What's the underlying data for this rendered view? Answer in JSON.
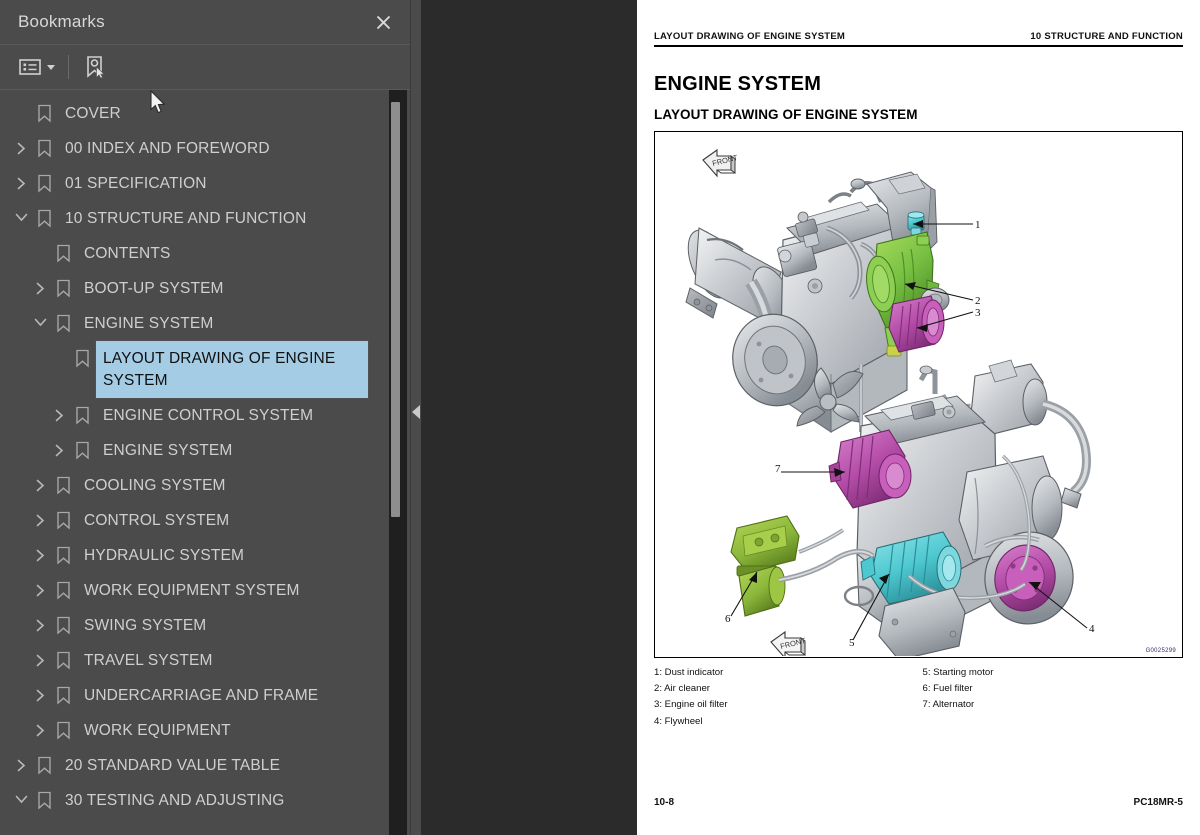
{
  "sidebar": {
    "title": "Bookmarks",
    "close_label": "×",
    "toolbar": {
      "options_icon": "list-options-icon",
      "options_caret": "chevron-down-icon",
      "new_bookmark_icon": "bookmark-pointer-icon"
    },
    "items": [
      {
        "label": "COVER",
        "level": 0,
        "state": "leaf",
        "selected": false
      },
      {
        "label": "00 INDEX AND FOREWORD",
        "level": 0,
        "state": "collapsed",
        "selected": false
      },
      {
        "label": "01 SPECIFICATION",
        "level": 0,
        "state": "collapsed",
        "selected": false
      },
      {
        "label": "10 STRUCTURE AND FUNCTION",
        "level": 0,
        "state": "expanded",
        "selected": false
      },
      {
        "label": "CONTENTS",
        "level": 1,
        "state": "leaf",
        "selected": false
      },
      {
        "label": "BOOT-UP SYSTEM",
        "level": 1,
        "state": "collapsed",
        "selected": false
      },
      {
        "label": "ENGINE SYSTEM",
        "level": 1,
        "state": "expanded",
        "selected": false
      },
      {
        "label": "LAYOUT DRAWING OF ENGINE SYSTEM",
        "level": 2,
        "state": "leaf",
        "selected": true
      },
      {
        "label": "ENGINE CONTROL SYSTEM",
        "level": 2,
        "state": "collapsed",
        "selected": false
      },
      {
        "label": "ENGINE SYSTEM",
        "level": 2,
        "state": "collapsed",
        "selected": false
      },
      {
        "label": "COOLING SYSTEM",
        "level": 1,
        "state": "collapsed",
        "selected": false
      },
      {
        "label": "CONTROL SYSTEM",
        "level": 1,
        "state": "collapsed",
        "selected": false
      },
      {
        "label": "HYDRAULIC SYSTEM",
        "level": 1,
        "state": "collapsed",
        "selected": false
      },
      {
        "label": "WORK EQUIPMENT SYSTEM",
        "level": 1,
        "state": "collapsed",
        "selected": false
      },
      {
        "label": "SWING SYSTEM",
        "level": 1,
        "state": "collapsed",
        "selected": false
      },
      {
        "label": "TRAVEL SYSTEM",
        "level": 1,
        "state": "collapsed",
        "selected": false
      },
      {
        "label": "UNDERCARRIAGE AND FRAME",
        "level": 1,
        "state": "collapsed",
        "selected": false
      },
      {
        "label": "WORK EQUIPMENT",
        "level": 1,
        "state": "collapsed",
        "selected": false
      },
      {
        "label": "20 STANDARD VALUE TABLE",
        "level": 0,
        "state": "collapsed",
        "selected": false
      },
      {
        "label": "30 TESTING AND ADJUSTING",
        "level": 0,
        "state": "expanded",
        "selected": false
      }
    ]
  },
  "splitter": {
    "collapse_icon": "triangle-left-icon"
  },
  "document": {
    "running_head_left": "LAYOUT DRAWING OF ENGINE SYSTEM",
    "running_head_right": "10 STRUCTURE AND FUNCTION",
    "h1": "ENGINE SYSTEM",
    "h2": "LAYOUT DRAWING OF ENGINE SYSTEM",
    "figure_code": "G0025299",
    "front_marker": "FRONT",
    "callouts": [
      "1",
      "2",
      "3",
      "4",
      "5",
      "6",
      "7"
    ],
    "legend_left": [
      "1: Dust indicator",
      "2: Air cleaner",
      "3: Engine oil filter",
      "4: Flywheel"
    ],
    "legend_right": [
      "5: Starting motor",
      "6: Fuel filter",
      "7: Alternator"
    ],
    "footer_left": "10-8",
    "footer_right": "PC18MR-5"
  },
  "colors": {
    "panel_bg": "#4b4b4b",
    "viewer_bg": "#2b2b2b",
    "selection": "#a4cde5",
    "text": "#cfcfcf",
    "part_green": "#76c043",
    "part_magenta": "#b44ca8",
    "part_cyan": "#4ec8d0",
    "part_olive": "#8cb83c",
    "part_teal": "#3aa8b8"
  }
}
